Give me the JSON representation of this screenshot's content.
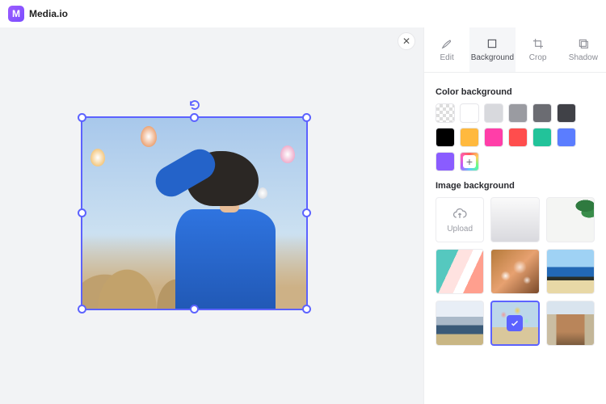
{
  "brand": {
    "name": "Media.io",
    "mark": "M"
  },
  "canvas": {
    "close_icon": "close-icon"
  },
  "tabs": {
    "edit": {
      "label": "Edit"
    },
    "background": {
      "label": "Background"
    },
    "crop": {
      "label": "Crop"
    },
    "shadow": {
      "label": "Shadow"
    },
    "active": "background"
  },
  "sections": {
    "color_bg": {
      "title": "Color background"
    },
    "image_bg": {
      "title": "Image background"
    }
  },
  "colors": [
    {
      "name": "transparent",
      "css": "checker"
    },
    {
      "name": "white",
      "css": "",
      "hex": "#ffffff"
    },
    {
      "name": "gray-200",
      "hex": "#d8d9dd"
    },
    {
      "name": "gray-400",
      "hex": "#9a9ba1"
    },
    {
      "name": "gray-600",
      "hex": "#6b6c72"
    },
    {
      "name": "gray-800",
      "hex": "#404147"
    },
    {
      "name": "black",
      "hex": "#000000"
    },
    {
      "name": "amber",
      "hex": "#ffb93e"
    },
    {
      "name": "pink",
      "hex": "#ff3ea8"
    },
    {
      "name": "red",
      "hex": "#ff4d4d"
    },
    {
      "name": "teal",
      "hex": "#22c39a"
    },
    {
      "name": "blue",
      "hex": "#5b7dff"
    },
    {
      "name": "violet",
      "hex": "#8a5cff"
    },
    {
      "name": "add",
      "css": "add"
    }
  ],
  "images": {
    "upload_label": "Upload",
    "items": [
      {
        "name": "upload",
        "kind": "upload"
      },
      {
        "name": "soft-gradient",
        "cls": "t-grad1"
      },
      {
        "name": "leaves",
        "cls": "t-leaf"
      },
      {
        "name": "pastel-stripes",
        "cls": "t-stripes"
      },
      {
        "name": "warm-bokeh",
        "cls": "t-bokeh"
      },
      {
        "name": "coast",
        "cls": "t-coast"
      },
      {
        "name": "mountains",
        "cls": "t-mtn"
      },
      {
        "name": "balloons",
        "cls": "t-balloons",
        "selected": true
      },
      {
        "name": "street",
        "cls": "t-street"
      }
    ]
  }
}
